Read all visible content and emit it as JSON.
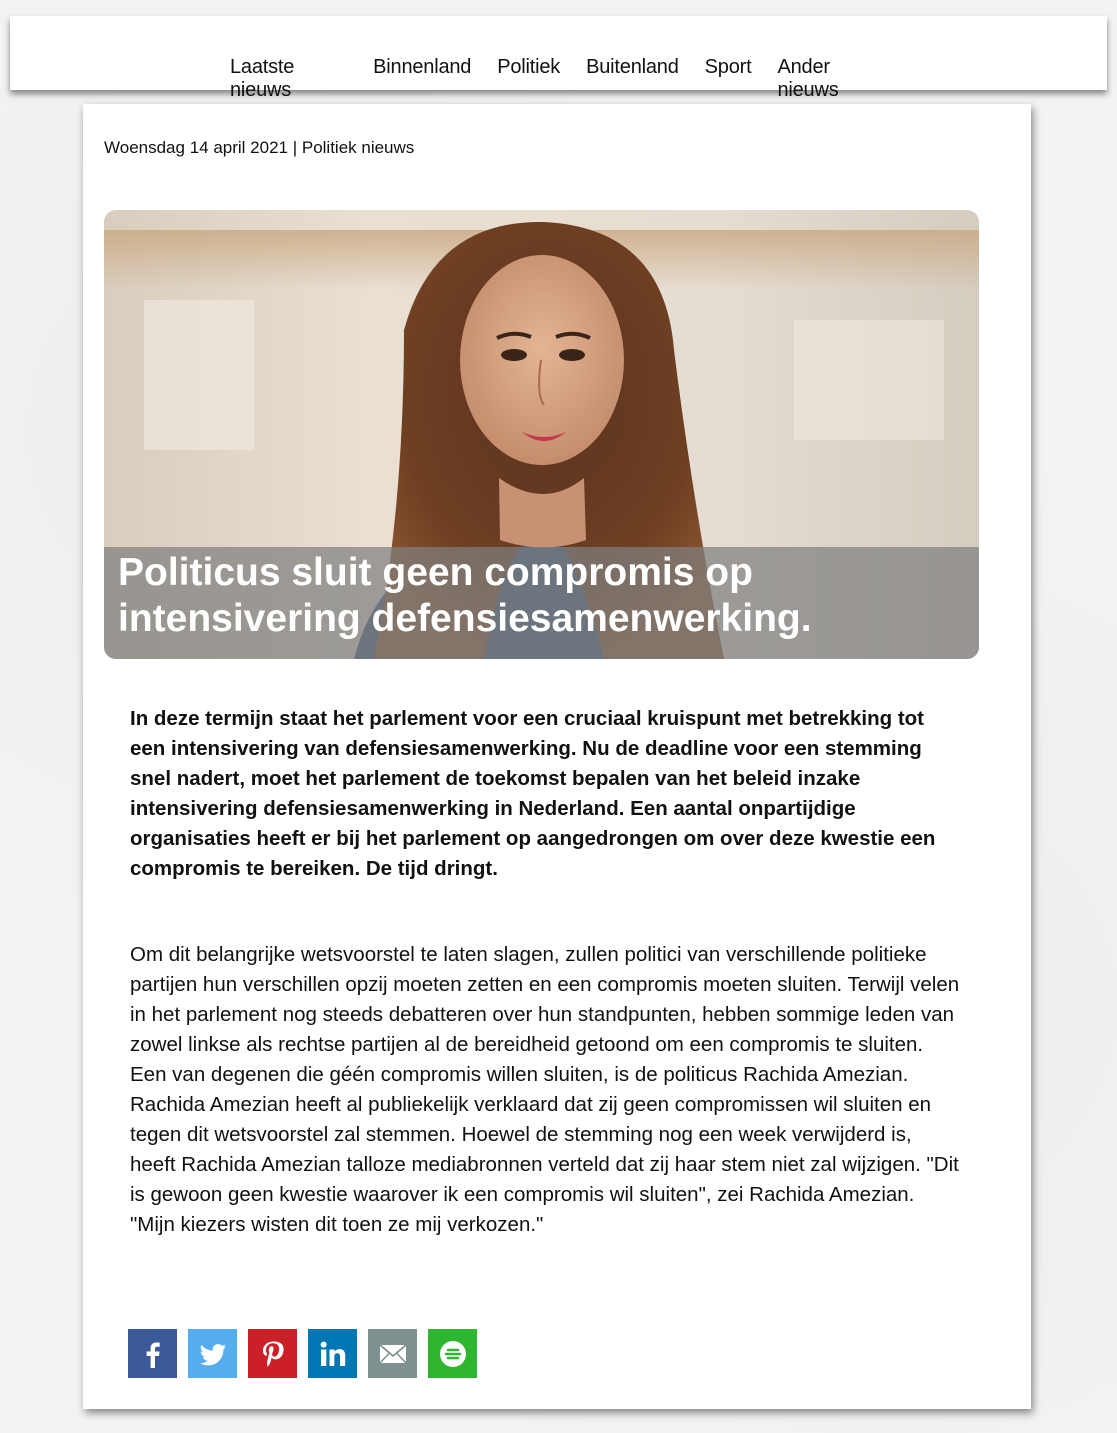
{
  "nav": {
    "items": [
      "Laatste nieuws",
      "Binnenland",
      "Politiek",
      "Buitenland",
      "Sport",
      "Ander nieuws"
    ]
  },
  "article": {
    "dateline": "Woensdag 14 april 2021 | Politiek nieuws",
    "headline_line1": "Politicus sluit geen compromis op",
    "headline_line2": "intensivering defensiesamenwerking.",
    "lead": "In deze termijn staat het parlement voor een cruciaal kruispunt met betrekking tot een intensivering van defensiesamenwerking. Nu de deadline voor een stemming snel nadert, moet het parlement de toekomst bepalen van het beleid inzake intensivering defensiesamenwerking in Nederland. Een aantal onpartijdige organisaties heeft er bij het parlement op aangedrongen om over deze kwestie een compromis te bereiken. De tijd dringt.",
    "body": "Om dit belangrijke wetsvoorstel te laten slagen, zullen politici van verschillende politieke partijen hun verschillen opzij moeten zetten en een compromis moeten sluiten. Terwijl velen in het parlement nog steeds debatteren over hun standpunten, hebben sommige leden van zowel linkse als rechtse partijen al de bereidheid getoond om een compromis te sluiten. Een van degenen die géén compromis willen sluiten, is de politicus Rachida Amezian. Rachida Amezian heeft al publiekelijk verklaard dat zij geen compromissen wil sluiten en tegen dit wetsvoorstel zal stemmen. Hoewel de stemming nog een week verwijderd is, heeft Rachida Amezian talloze mediabronnen verteld dat zij haar stem niet zal wijzigen. \"Dit is gewoon geen kwestie waarover ik een compromis wil sluiten\", zei Rachida Amezian. \"Mijn kiezers wisten dit toen ze mij verkozen.\""
  },
  "share": [
    {
      "icon": "facebook-icon",
      "color": "#3b5998"
    },
    {
      "icon": "twitter-icon",
      "color": "#55acee"
    },
    {
      "icon": "pinterest-icon",
      "color": "#cb2027"
    },
    {
      "icon": "linkedin-icon",
      "color": "#0077b5"
    },
    {
      "icon": "email-icon",
      "color": "#7f9090"
    },
    {
      "icon": "more-icon",
      "color": "#2fb52f"
    }
  ]
}
